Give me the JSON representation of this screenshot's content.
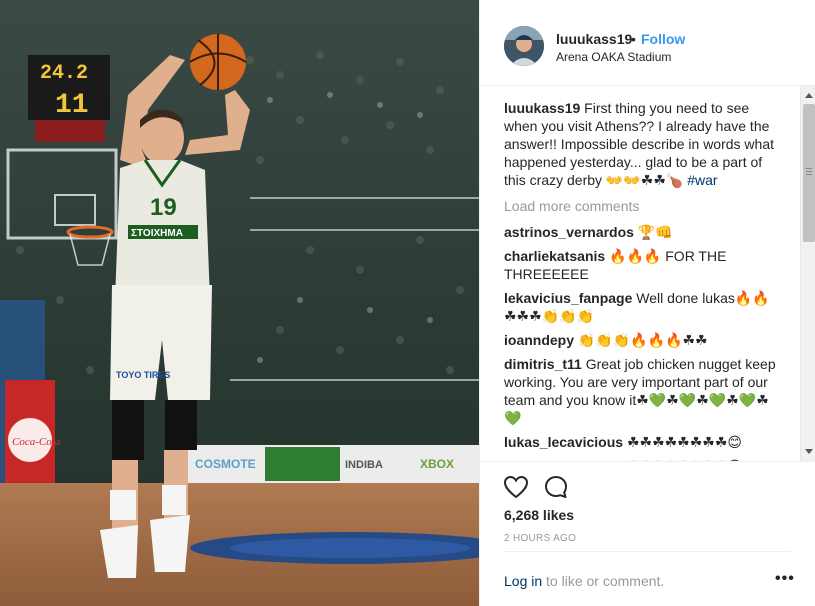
{
  "header": {
    "username": "luuukass19",
    "separator": "•",
    "follow_label": "Follow",
    "location": "Arena OAKA Stadium"
  },
  "photo": {
    "scoreboard_top": "24.2",
    "scoreboard_bottom": "11",
    "jersey_number": "19",
    "jersey_sponsor": "ΣΤΟΙΧΗΜΑ",
    "shorts_sponsor": "TOYO TIRES",
    "ad_boards": [
      "COSMOTE",
      "INDIBA",
      "XBOX"
    ]
  },
  "caption": {
    "username": "luuukass19",
    "text": " First thing you need to see when you visit Athens?? I already have the answer!! Impossible describe in words what happened yesterday... glad to be a part of this crazy derby 👐👐☘☘🍗 ",
    "hashtag": "#war"
  },
  "load_more": "Load more comments",
  "comments": [
    {
      "username": "astrinos_vernardos",
      "text": " 🏆👊"
    },
    {
      "username": "charliekatsanis",
      "text": " 🔥🔥🔥 FOR THE THREEEEEE"
    },
    {
      "username": "lekavicius_fanpage",
      "text": " Well done lukas🔥🔥☘☘☘👏👏👏"
    },
    {
      "username": "ioanndepy",
      "text": " 👏👏👏🔥🔥🔥☘☘"
    },
    {
      "username": "dimitris_t11",
      "text": " Great job chicken nugget keep working. You are very important part of our team and you know it☘💚☘💚☘💚☘💚☘💚"
    },
    {
      "username": "lukas_lecavicious",
      "text": " ☘☘☘☘☘☘☘☘😊"
    },
    {
      "username": "lukas_lecavicious",
      "text": " ☘☘☘☘☘☘☘☘😊"
    }
  ],
  "actions": {
    "likes": "6,268 likes",
    "time_ago": "2 HOURS AGO",
    "login_link": "Log in",
    "login_rest": " to like or comment.",
    "more": "•••"
  },
  "colors": {
    "accent": "#3897f0",
    "link": "#003569",
    "muted": "#999999",
    "border": "#efefef"
  },
  "icons": [
    "heart-icon",
    "comment-icon",
    "more-options-icon",
    "scroll-up-icon",
    "scroll-down-icon"
  ]
}
